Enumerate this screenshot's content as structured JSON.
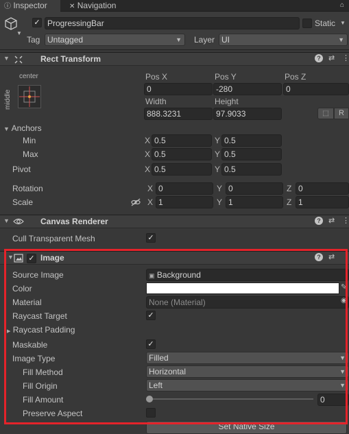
{
  "tabs": {
    "inspector": "Inspector",
    "navigation": "Navigation"
  },
  "object": {
    "name": "ProgressingBar",
    "static_label": "Static",
    "tag_label": "Tag",
    "tag_value": "Untagged",
    "layer_label": "Layer",
    "layer_value": "UI"
  },
  "rect_transform": {
    "title": "Rect Transform",
    "anchor_h": "center",
    "anchor_v": "middle",
    "pos_x_label": "Pos X",
    "pos_y_label": "Pos Y",
    "pos_z_label": "Pos Z",
    "pos_x": "0",
    "pos_y": "-280",
    "pos_z": "0",
    "width_label": "Width",
    "height_label": "Height",
    "width": "888.3231",
    "height": "97.9033",
    "r_label": "R",
    "anchors_label": "Anchors",
    "min_label": "Min",
    "max_label": "Max",
    "pivot_label": "Pivot",
    "min_x": "0.5",
    "min_y": "0.5",
    "max_x": "0.5",
    "max_y": "0.5",
    "pivot_x": "0.5",
    "pivot_y": "0.5",
    "rotation_label": "Rotation",
    "scale_label": "Scale",
    "rot_x": "0",
    "rot_y": "0",
    "rot_z": "0",
    "scale_x": "1",
    "scale_y": "1",
    "scale_z": "1",
    "axis_x": "X",
    "axis_y": "Y",
    "axis_z": "Z"
  },
  "canvas_renderer": {
    "title": "Canvas Renderer",
    "cull_label": "Cull Transparent Mesh"
  },
  "image": {
    "title": "Image",
    "source_image_label": "Source Image",
    "source_image_value": "Background",
    "color_label": "Color",
    "color_value": "#ffffff",
    "material_label": "Material",
    "material_value": "None (Material)",
    "raycast_target_label": "Raycast Target",
    "raycast_padding_label": "Raycast Padding",
    "maskable_label": "Maskable",
    "image_type_label": "Image Type",
    "image_type_value": "Filled",
    "fill_method_label": "Fill Method",
    "fill_method_value": "Horizontal",
    "fill_origin_label": "Fill Origin",
    "fill_origin_value": "Left",
    "fill_amount_label": "Fill Amount",
    "fill_amount_value": "0",
    "preserve_aspect_label": "Preserve Aspect",
    "set_native_size_label": "Set Native Size"
  },
  "icons": {
    "checkmark": "✓",
    "help": "?",
    "settings": "⇄",
    "more": "⋮",
    "lock": "🔒"
  },
  "colors": {
    "highlight": "#e5232a",
    "background": "#383838",
    "field": "#2a2a2a"
  }
}
